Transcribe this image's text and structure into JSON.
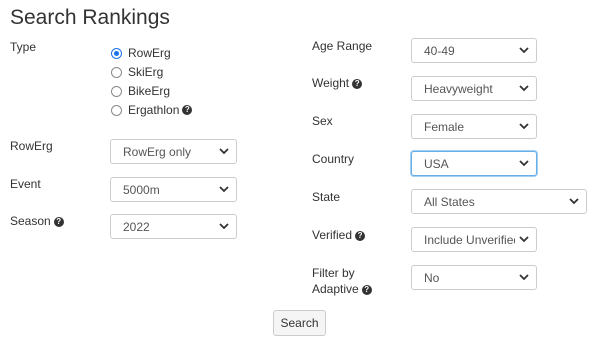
{
  "page_title": "Search Rankings",
  "type": {
    "label": "Type",
    "options": [
      {
        "label": "RowErg",
        "checked": true
      },
      {
        "label": "SkiErg",
        "checked": false
      },
      {
        "label": "BikeErg",
        "checked": false
      },
      {
        "label": "Ergathlon",
        "checked": false
      }
    ],
    "help_icon": "question-circle-icon"
  },
  "left_fields": {
    "rowerg": {
      "label": "RowErg",
      "value": "RowErg only"
    },
    "event": {
      "label": "Event",
      "value": "5000m"
    },
    "season": {
      "label": "Season",
      "value": "2022"
    }
  },
  "right_fields": {
    "age_range": {
      "label": "Age Range",
      "value": "40-49"
    },
    "weight": {
      "label": "Weight",
      "value": "Heavyweight"
    },
    "sex": {
      "label": "Sex",
      "value": "Female"
    },
    "country": {
      "label": "Country",
      "value": "USA"
    },
    "state": {
      "label": "State",
      "value": "All States"
    },
    "verified": {
      "label": "Verified",
      "value": "Include Unverified"
    },
    "filter_adaptive": {
      "label_line1": "Filter by",
      "label_line2": "Adaptive",
      "value": "No"
    }
  },
  "search_button": "Search",
  "colors": {
    "accent": "#1a73e8",
    "focus": "#66afe9"
  }
}
